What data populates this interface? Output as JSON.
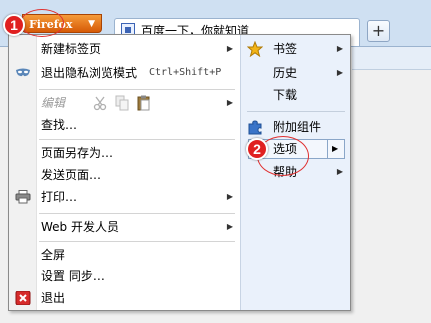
{
  "firefox_button": {
    "label": "Firefox",
    "caret": "▼"
  },
  "tab": {
    "title": "百度一下，你就知道",
    "icon": "baidu-favicon"
  },
  "new_tab": {
    "label": "+"
  },
  "menu": {
    "left": [
      {
        "label": "新建标签页",
        "submenu": true
      },
      {
        "label": "退出隐私浏览模式",
        "shortcut": "Ctrl+Shift+P",
        "icon": "mask-icon"
      },
      {
        "label": "编辑",
        "submenu": true,
        "disabled": true,
        "icons": [
          "cut-icon",
          "copy-icon",
          "paste-icon"
        ]
      },
      {
        "label": "查找…"
      },
      {
        "label": "页面另存为…"
      },
      {
        "label": "发送页面…"
      },
      {
        "label": "打印…",
        "submenu": true,
        "icon": "printer-icon"
      },
      {
        "label": "Web 开发人员",
        "submenu": true
      },
      {
        "label": "全屏"
      },
      {
        "label": "设置 同步…"
      },
      {
        "label": "退出",
        "icon": "exit-icon"
      }
    ],
    "right": [
      {
        "label": "书签",
        "submenu": true,
        "icon": "star-icon"
      },
      {
        "label": "历史",
        "submenu": true
      },
      {
        "label": "下载"
      },
      {
        "label": "附加组件",
        "icon": "puzzle-icon"
      },
      {
        "label": "选项",
        "submenu": true,
        "highlighted": true
      },
      {
        "label": "帮助",
        "submenu": true
      }
    ]
  },
  "callouts": [
    {
      "number": "1"
    },
    {
      "number": "2"
    }
  ],
  "colors": {
    "firefox_orange": "#e8750f",
    "badge_red": "#e02020",
    "menu_border": "#8a8a8a",
    "right_panel": "#eaf1fb"
  }
}
